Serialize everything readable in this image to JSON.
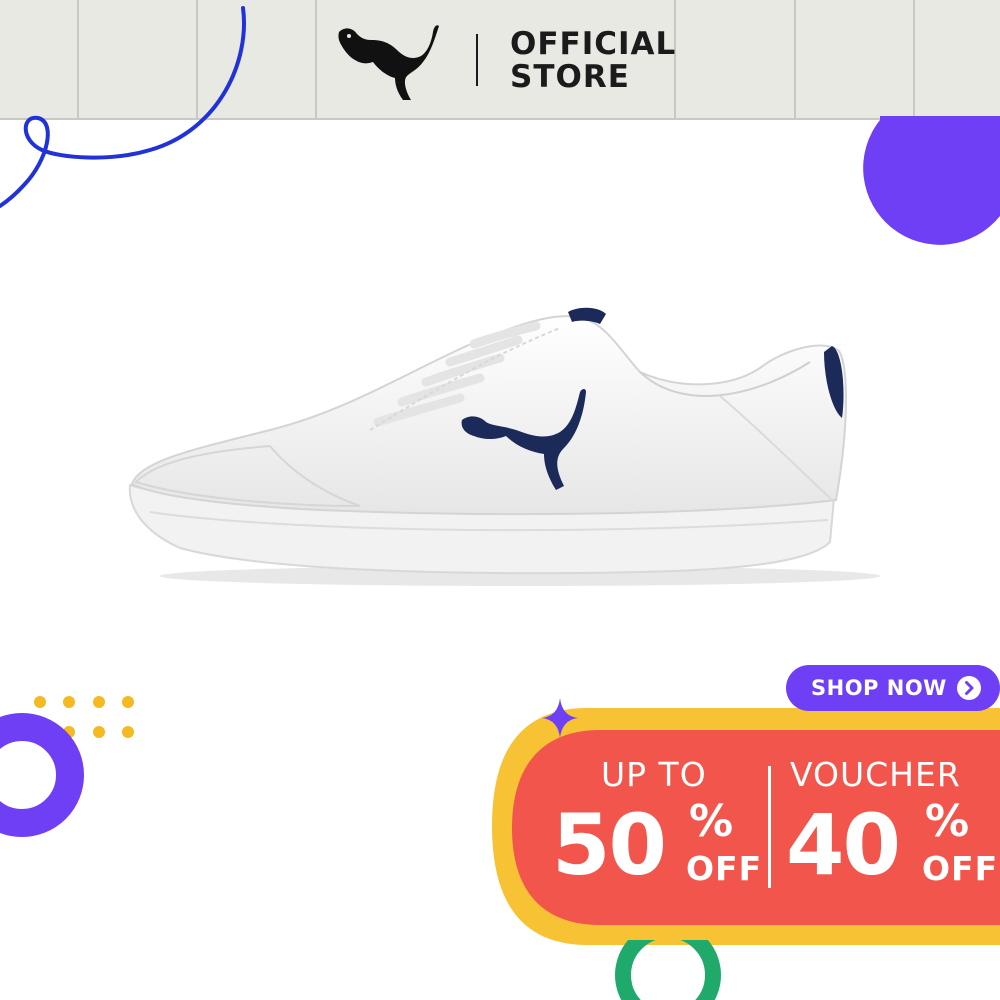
{
  "header": {
    "brand_logo_icon": "puma-cat-logo",
    "store_line1": "OFFICIAL",
    "store_line2": "STORE"
  },
  "product": {
    "image_icon": "white-leather-sneaker-navy-cat-logo"
  },
  "promo": {
    "shop_now_label": "SHOP NOW",
    "shop_now_icon": "chevron-right-circle-icon",
    "left_heading": "UP TO",
    "left_value": "50",
    "left_percent": "%",
    "left_suffix": "OFF",
    "right_heading": "VOUCHER",
    "right_value": "40",
    "right_percent": "%",
    "right_suffix": "OFF"
  },
  "colors": {
    "header_bg": "#e9e9e4",
    "accent_purple": "#6f3ff5",
    "banner_red": "#f2554c",
    "banner_yellow": "#f7c233",
    "stroke_blue": "#2032d8",
    "ring_green": "#1faa6b",
    "dot_yellow": "#f5b921",
    "shoe_navy": "#1c2a5a"
  }
}
